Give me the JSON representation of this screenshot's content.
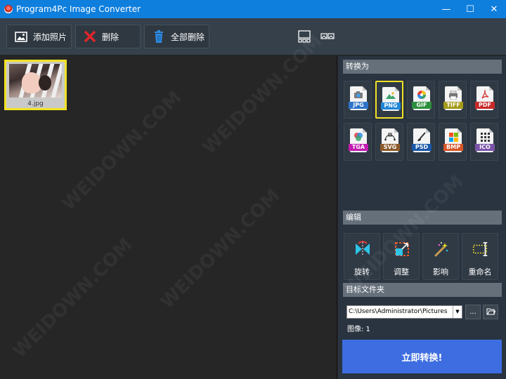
{
  "window": {
    "title": "Program4Pc Image Converter",
    "minimize": "—",
    "maximize": "☐",
    "close": "✕"
  },
  "toolbar": {
    "add_label": "添加照片",
    "delete_label": "删除",
    "delete_all_label": "全部删除"
  },
  "files": [
    {
      "name": "4.jpg"
    }
  ],
  "convert_section": {
    "heading": "转换为",
    "formats": [
      {
        "label": "JPG",
        "color": "#2f73c9",
        "icon": "camera-icon",
        "selected": false
      },
      {
        "label": "PNG",
        "color": "#1f86d9",
        "icon": "image-icon",
        "selected": true
      },
      {
        "label": "GIF",
        "color": "#2c8f3c",
        "icon": "gif-color-wheel-icon",
        "selected": false
      },
      {
        "label": "TIFF",
        "color": "#a49b1a",
        "icon": "printer-icon",
        "selected": false
      },
      {
        "label": "PDF",
        "color": "#c82a2a",
        "icon": "pdf-icon",
        "selected": false
      },
      {
        "label": "TGA",
        "color": "#c21cb0",
        "icon": "rgb-circles-icon",
        "selected": false
      },
      {
        "label": "SVG",
        "color": "#8b5a2b",
        "icon": "vector-pen-icon",
        "selected": false
      },
      {
        "label": "PSD",
        "color": "#1957a8",
        "icon": "brush-icon",
        "selected": false
      },
      {
        "label": "BMP",
        "color": "#d7562a",
        "icon": "windows-icon",
        "selected": false
      },
      {
        "label": "ICO",
        "color": "#7a54a8",
        "icon": "icon-grid-icon",
        "selected": false
      }
    ]
  },
  "edit_section": {
    "heading": "编辑",
    "tools": [
      {
        "label": "旋转",
        "icon": "rotate-icon"
      },
      {
        "label": "调整",
        "icon": "resize-icon"
      },
      {
        "label": "影响",
        "icon": "magic-wand-icon"
      },
      {
        "label": "重命名",
        "icon": "rename-icon"
      }
    ]
  },
  "target_section": {
    "heading": "目标文件夹",
    "path": "C:\\Users\\Administrator\\Pictures",
    "browse_label": "...",
    "image_count": "图像: 1"
  },
  "convert_button": "立即转换!",
  "watermark": "WEIDOWN.COM",
  "colors": {
    "titlebar": "#0f7fde",
    "accent_selection": "#f3e225",
    "convert_button": "#3d6de0"
  }
}
